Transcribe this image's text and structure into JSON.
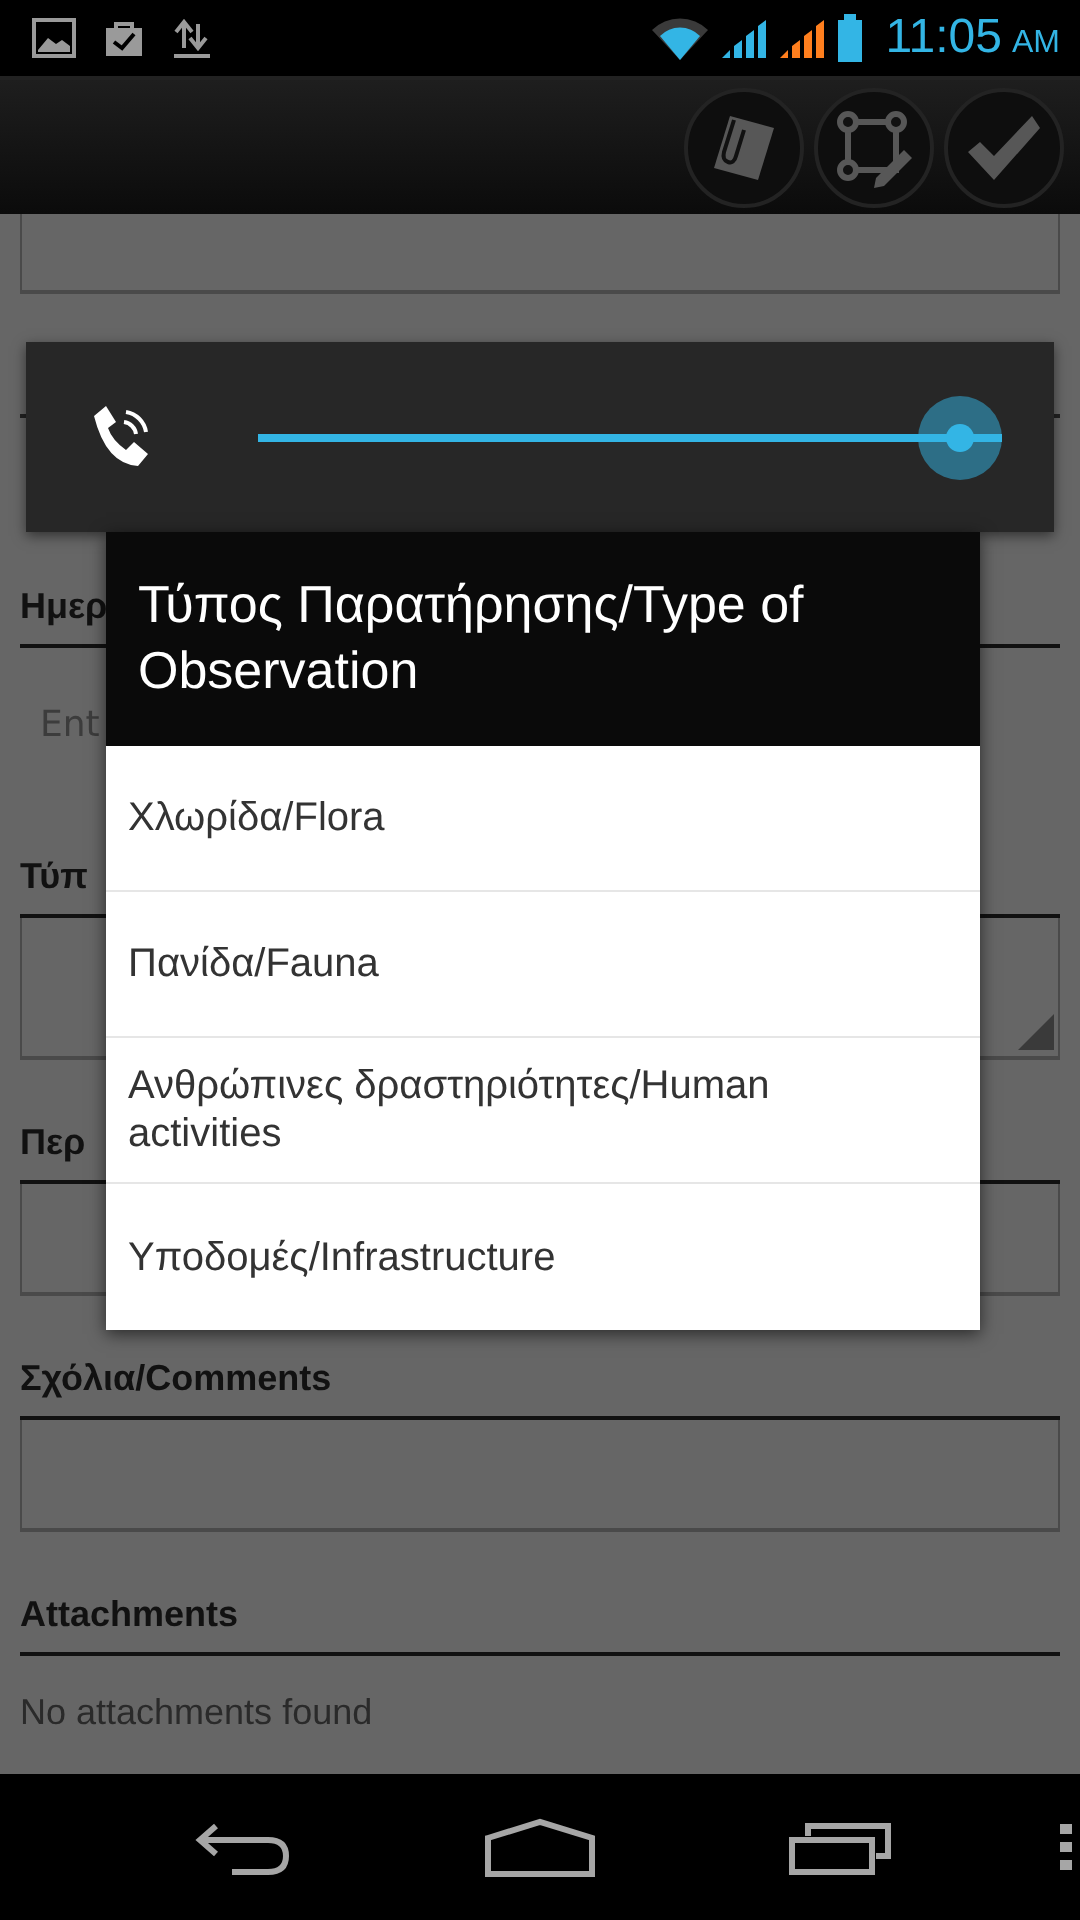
{
  "status_bar": {
    "time": "11:05",
    "ampm": "AM"
  },
  "action_bar": {
    "buttons": [
      {
        "kind": "attach"
      },
      {
        "kind": "draw"
      },
      {
        "kind": "confirm"
      }
    ]
  },
  "form": {
    "items": [
      {
        "kind": "label",
        "text": "Ημερ"
      },
      {
        "kind": "text-field",
        "placeholder": "Ent"
      },
      {
        "kind": "label",
        "text": "Τύπ"
      },
      {
        "kind": "spinner"
      },
      {
        "kind": "label",
        "text": "Περ"
      },
      {
        "kind": "field"
      },
      {
        "kind": "label",
        "text": "Σχόλια/Comments"
      },
      {
        "kind": "field"
      },
      {
        "kind": "label",
        "text": "Attachments"
      },
      {
        "kind": "note",
        "text": "No attachments found"
      }
    ]
  },
  "volume_panel": {
    "level": 1
  },
  "dialog": {
    "title": "Τύπος Παρατήρησης/Type of Observation",
    "options": [
      "Χλωρίδα/Flora",
      "Πανίδα/Fauna",
      "Ανθρώπινες δραστηριότητες/Human activities",
      "Υποδομές/Infrastructure"
    ]
  }
}
